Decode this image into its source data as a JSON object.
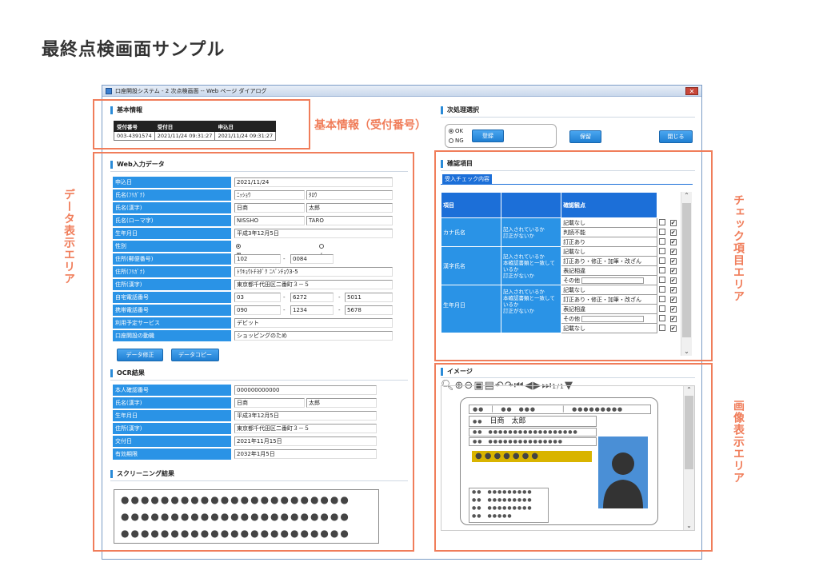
{
  "page_title": "最終点検画面サンプル",
  "window": {
    "title": "口座開設システム - 2 次点検画面 -- Web ページ ダイアログ",
    "close_label": "✕"
  },
  "basic_info": {
    "title": "基本情報",
    "headers": [
      "受付番号",
      "受付日",
      "申込日"
    ],
    "values": [
      "003-4391574",
      "2021/11/24 09:31:27",
      "2021/11/24 09:31:27"
    ]
  },
  "next_process": {
    "title": "次処理選択",
    "option_ok": "OK",
    "option_ng": "NG",
    "register_button": "登録",
    "hold_button": "保留",
    "close_button": "閉じる"
  },
  "web_input": {
    "title": "Web入力データ",
    "rows": [
      {
        "label": "申込日",
        "values": [
          "2021/11/24"
        ]
      },
      {
        "label": "氏名(ﾌﾘｶﾞﾅ)",
        "values": [
          "ﾆｯｼｮｳ",
          "ﾀﾛｳ"
        ]
      },
      {
        "label": "氏名(漢字)",
        "values": [
          "日商",
          "太郎"
        ]
      },
      {
        "label": "氏名(ローマ字)",
        "values": [
          "NISSHO",
          "TARO"
        ]
      },
      {
        "label": "生年月日",
        "values": [
          "平成3年12月5日"
        ]
      },
      {
        "label": "性別",
        "values": [
          "男",
          "女"
        ]
      },
      {
        "label": "住所(郵便番号)",
        "values": [
          "102",
          "0084"
        ]
      },
      {
        "label": "住所(ﾌﾘｶﾞﾅ)",
        "values": [
          "ﾄｳｷｮｳﾄﾁﾖﾀﾞｸ ﾆﾊﾞﾝﾁｮｳ3-5"
        ]
      },
      {
        "label": "住所(漢字)",
        "values": [
          "東京都千代田区二番町３－５"
        ]
      },
      {
        "label": "自宅電話番号",
        "values": [
          "03",
          "6272",
          "5011"
        ]
      },
      {
        "label": "携帯電話番号",
        "values": [
          "090",
          "1234",
          "5678"
        ]
      },
      {
        "label": "利用予定サービス",
        "values": [
          "デビット"
        ]
      },
      {
        "label": "口座開設の動機",
        "values": [
          "ショッピングのため"
        ]
      }
    ],
    "edit_button": "データ修正",
    "copy_button": "データコピー"
  },
  "ocr": {
    "title": "OCR結果",
    "rows": [
      {
        "label": "本人確認番号",
        "values": [
          "000000000000"
        ]
      },
      {
        "label": "氏名(漢字)",
        "values": [
          "日商",
          "太郎"
        ]
      },
      {
        "label": "生年月日",
        "values": [
          "平成3年12月5日"
        ]
      },
      {
        "label": "住所(漢字)",
        "values": [
          "東京都千代田区二番町３－５"
        ]
      },
      {
        "label": "交付日",
        "values": [
          "2021年11月15日"
        ]
      },
      {
        "label": "有効期限",
        "values": [
          "2032年1月5日"
        ]
      }
    ]
  },
  "screening": {
    "title": "スクリーニング結果",
    "masked_line": "●●●●●●●●●●●●●●●●●●●●●●●"
  },
  "check": {
    "title": "確認項目",
    "tab": "受入チェック内容",
    "headers": {
      "item": "項目",
      "point": "確認観点",
      "yes": "はい",
      "no": "いいえ"
    },
    "groups": [
      {
        "item": "カナ氏名",
        "point": "記入されているか\n訂正がないか",
        "options": [
          "記載なし",
          "判読不能",
          "訂正あり"
        ]
      },
      {
        "item": "漢字氏名",
        "point": "記入されているか\n本確認書類と一致しているか\n訂正がないか",
        "options": [
          "記載なし",
          "訂正あり・修正・加筆・改ざん",
          "表記相違",
          "その他"
        ]
      },
      {
        "item": "生年月日",
        "point": "記入されているか\n本確認書類と一致しているか\n訂正がないか",
        "options": [
          "記載なし",
          "訂正あり・修正・加筆・改ざん",
          "表記相違",
          "その他",
          "記載なし"
        ]
      }
    ]
  },
  "image": {
    "title": "イメージ",
    "page_indicator": "1/1",
    "card_name": "日商　太郎"
  },
  "areas": {
    "basic": "基本情報（受付番号）",
    "data": "データ表示エリア",
    "check": "チェック項目エリア",
    "image": "画像表示エリア"
  },
  "colors": {
    "accent": "#2a93e6",
    "annotation": "#f07d5a",
    "card_highlight": "#d9b400"
  }
}
